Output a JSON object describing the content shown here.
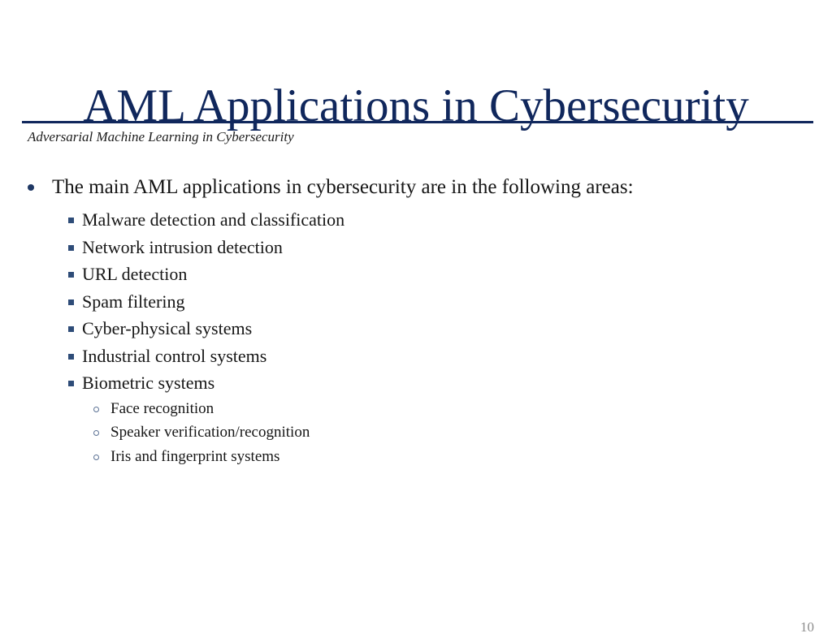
{
  "slide": {
    "title": "AML Applications in Cybersecurity",
    "subtitle": "Adversarial Machine Learning in Cybersecurity",
    "page_number": "10",
    "colors": {
      "title": "#10275c",
      "rule": "#10275c",
      "level1_bullet": "#1f3864",
      "level2_bullet": "#2e4c78",
      "level3_bullet": "#5b7194",
      "body_text": "#161616",
      "page_number": "#8d8d8d",
      "background": "#ffffff"
    }
  },
  "content": {
    "lead": "The main AML applications in cybersecurity are in the following areas:",
    "areas": [
      {
        "label": "Malware detection and classification"
      },
      {
        "label": "Network intrusion detection"
      },
      {
        "label": "URL detection"
      },
      {
        "label": "Spam filtering"
      },
      {
        "label": "Cyber-physical systems"
      },
      {
        "label": "Industrial control systems"
      },
      {
        "label": "Biometric systems"
      }
    ],
    "biometric_subitems": [
      {
        "label": "Face recognition"
      },
      {
        "label": "Speaker verification/recognition"
      },
      {
        "label": "Iris and fingerprint systems"
      }
    ]
  }
}
